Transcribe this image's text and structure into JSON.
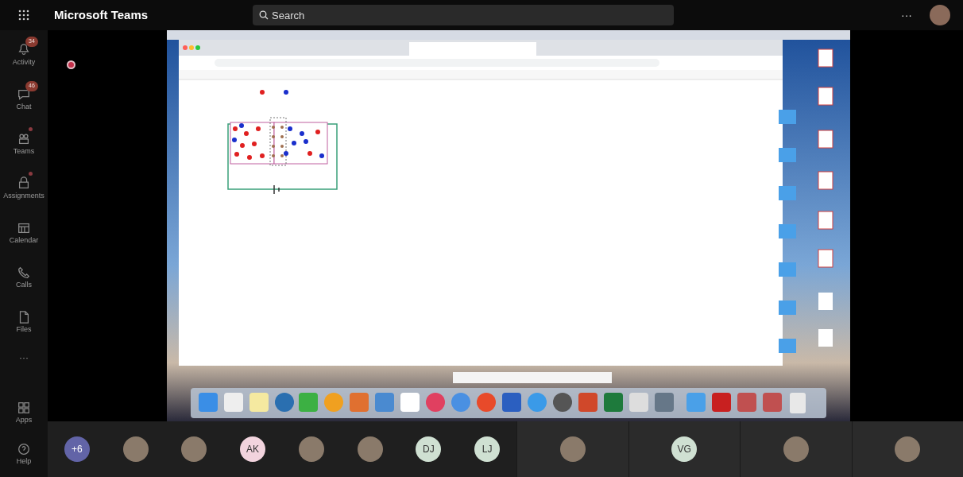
{
  "app": {
    "title": "Microsoft Teams"
  },
  "search": {
    "placeholder": "Search"
  },
  "more_label": "···",
  "rail": [
    {
      "label": "Activity",
      "badge": "34",
      "dot": false
    },
    {
      "label": "Chat",
      "badge": "46",
      "dot": false
    },
    {
      "label": "Teams",
      "dot": true
    },
    {
      "label": "Assignments",
      "dot": true
    },
    {
      "label": "Calendar",
      "dot": false
    },
    {
      "label": "Calls",
      "dot": false
    },
    {
      "label": "Files",
      "dot": false
    }
  ],
  "rail_more": "···",
  "rail_bottom": [
    {
      "label": "Apps"
    },
    {
      "label": "Help"
    }
  ],
  "recording": true,
  "participants": [
    {
      "kind": "count",
      "text": "+6"
    },
    {
      "kind": "photo"
    },
    {
      "kind": "photo"
    },
    {
      "kind": "initials",
      "text": "AK",
      "color": "#f2d4de"
    },
    {
      "kind": "photo"
    },
    {
      "kind": "photo"
    },
    {
      "kind": "initials",
      "text": "DJ",
      "color": "#cfe0d2"
    },
    {
      "kind": "initials",
      "text": "LJ",
      "color": "#cfe0d2"
    }
  ],
  "video_tiles": [
    {
      "kind": "photo"
    },
    {
      "kind": "initials",
      "text": "VG",
      "color": "#cfe0d2"
    },
    {
      "kind": "photo"
    },
    {
      "kind": "photo"
    }
  ]
}
